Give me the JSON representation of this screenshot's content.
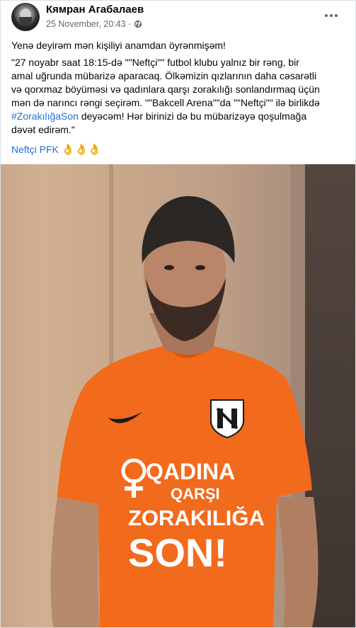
{
  "post": {
    "author": "Кямран Агабалаев",
    "timestamp": "25 November, 20:43 ·",
    "privacy_icon": "globe-icon",
    "more_icon": "more-horizontal-icon",
    "paragraph_1": "Yenə deyirəm mən kişiliyi anamdan öyrənmişəm!",
    "paragraph_2_lines": [
      "\"27 noyabr saat 18:15-də \"\"Neftçi\"\" futbol klubu yalnız bir rəng, bir",
      "amal uğrunda mübarizə aparacaq. Ölkəmizin qızlarının daha cəsarətli",
      "və qorxmaz böyüməsi və qadınlara qarşı zorakılığı sonlandırmaq üçün",
      "mən də narıncı rəngi seçirəm. \"\"Bakcell Arena\"\"da \"\"Neftçi\"\" ilə birlikdə"
    ],
    "hashtag": "#ZorakılığaSon",
    "paragraph_2_after_hashtag": " deyəcəm! Hər birinizi də bu mübarizəyə qoşulmağa",
    "paragraph_2_last_line": "dəvət edirəm.\"",
    "page_link": "Neftçi PFK",
    "emojis": "👌👌👌"
  },
  "shirt": {
    "line_1": "QADINA",
    "line_2": "QARŞI",
    "line_3": "ZORAKILIĞA",
    "line_4": "SON!"
  },
  "colors": {
    "link": "#216fdb",
    "shirt": "#f26a1b",
    "shirt_text": "#ffffff"
  }
}
